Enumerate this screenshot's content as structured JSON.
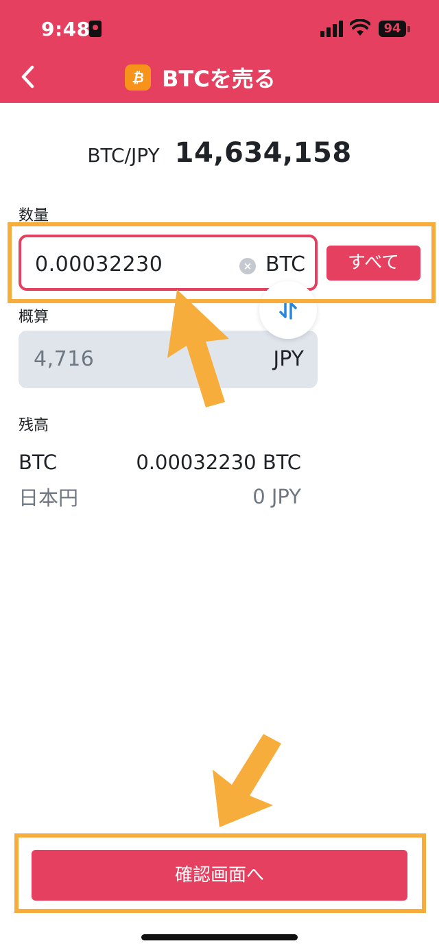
{
  "status_bar": {
    "time": "9:48",
    "battery": "94"
  },
  "header": {
    "title": "BTCを売る",
    "coin_symbol": "₿",
    "back_icon": "chevron-left-icon"
  },
  "rate": {
    "pair": "BTC/JPY",
    "value": "14,634,158"
  },
  "quantity": {
    "label": "数量",
    "value": "0.00032230",
    "unit": "BTC",
    "all_button": "すべて"
  },
  "estimate": {
    "label": "概算",
    "value": "4,716",
    "unit": "JPY"
  },
  "balance": {
    "label": "残高",
    "rows": [
      {
        "name": "BTC",
        "amount": "0.00032230 BTC"
      },
      {
        "name": "日本円",
        "amount": "0 JPY"
      }
    ]
  },
  "confirm_button": "確認画面へ",
  "colors": {
    "brand": "#e5405f",
    "bitcoin": "#f7931a",
    "highlight": "#f7ad3b",
    "swap": "#2a86d9"
  }
}
